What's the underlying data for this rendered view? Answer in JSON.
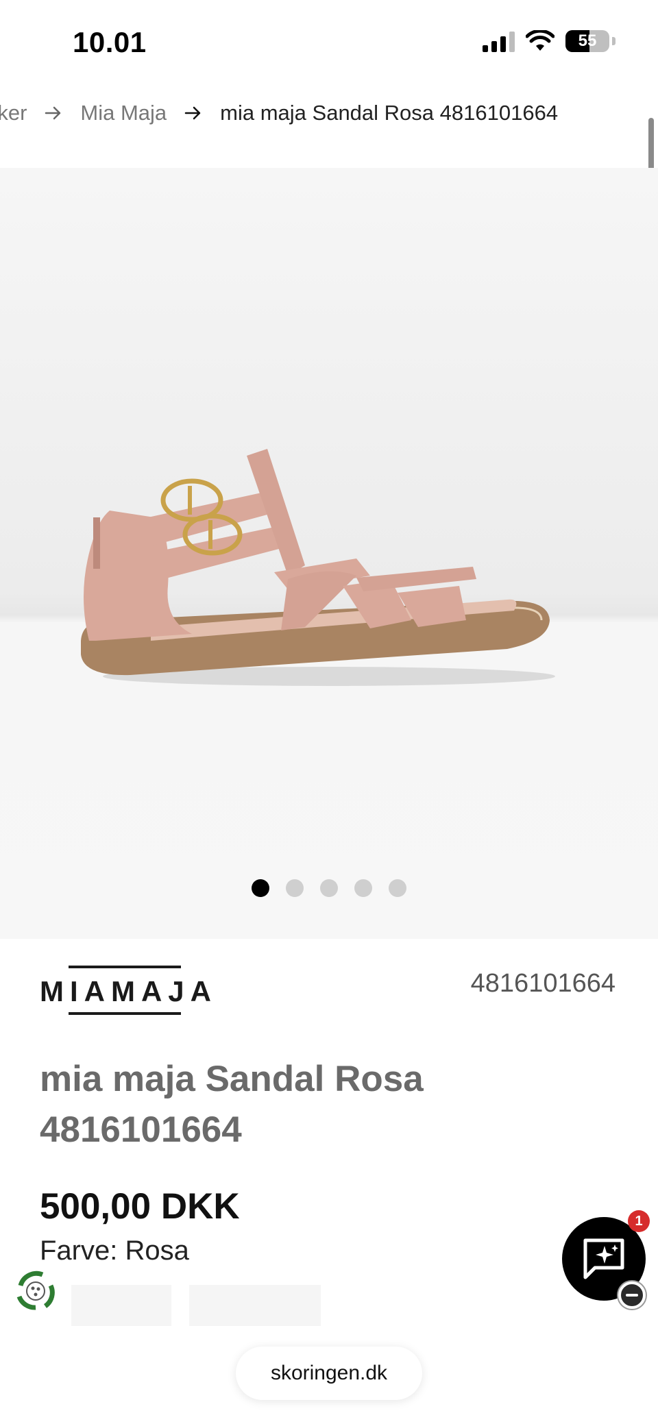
{
  "status_bar": {
    "time": "10.01",
    "battery_level": "55"
  },
  "breadcrumb": {
    "items": [
      "rker",
      "Mia Maja"
    ],
    "current": "mia maja Sandal Rosa 4816101664"
  },
  "gallery": {
    "image_alt": "Pink gladiator sandal with gold buckles",
    "image_count": 5,
    "active_index": 0
  },
  "product": {
    "brand_logo_text": "MIAMAJA",
    "sku": "4816101664",
    "title": "mia maja Sandal Rosa 4816101664",
    "price": "500,00 DKK",
    "color_label": "Farve: Rosa"
  },
  "chat": {
    "badge_count": "1"
  },
  "browser": {
    "url": "skoringen.dk"
  },
  "colors": {
    "sandal": "#d9a89a",
    "sole": "#a98462",
    "buckle": "#c9a24a",
    "badge": "#d62c2c",
    "eco_green": "#2e7d32"
  }
}
